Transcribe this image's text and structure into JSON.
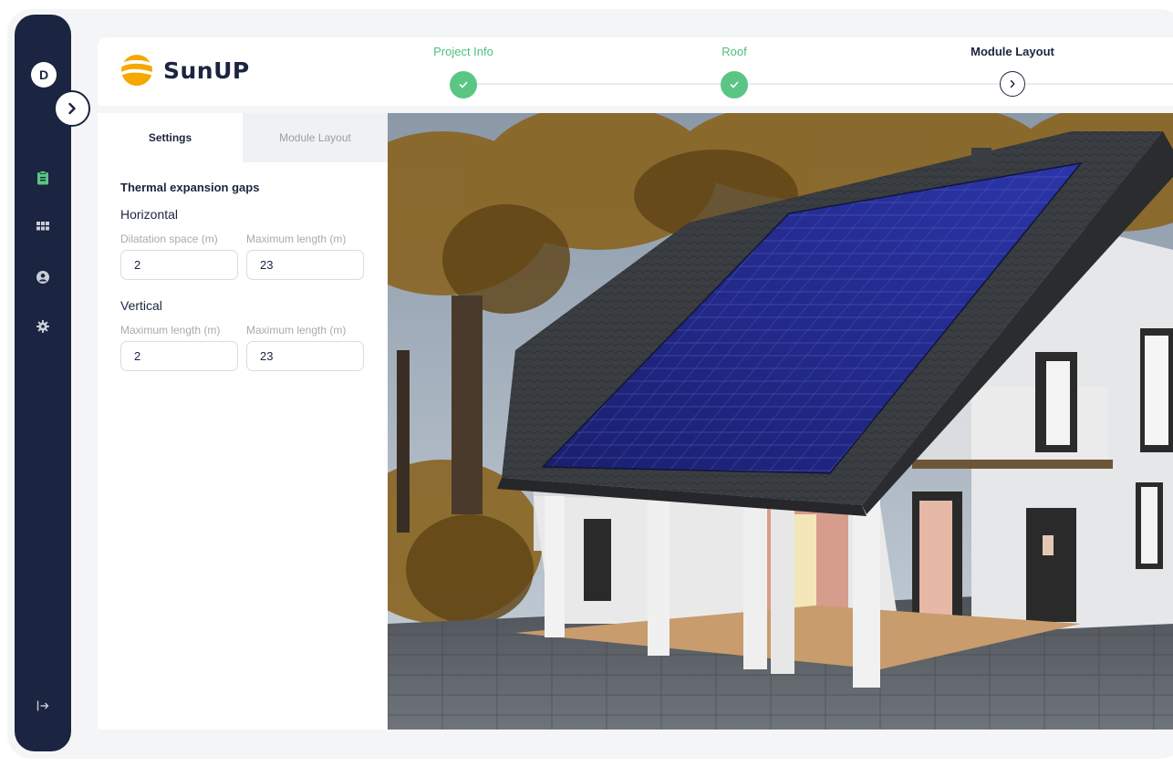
{
  "user": {
    "initial": "D"
  },
  "sidebar": {
    "items": [
      {
        "name": "clipboard-icon",
        "active": true
      },
      {
        "name": "grid-icon",
        "active": false
      },
      {
        "name": "user-icon",
        "active": false
      },
      {
        "name": "gear-icon",
        "active": false
      }
    ],
    "logout_icon": "logout-icon"
  },
  "brand": {
    "name": "SunUP",
    "color": "#1b2440",
    "accent": "#f5a800"
  },
  "stepper": {
    "steps": [
      {
        "label": "Project Info",
        "status": "done"
      },
      {
        "label": "Roof",
        "status": "done"
      },
      {
        "label": "Module Layout",
        "status": "current"
      }
    ],
    "done_color": "#5bc584"
  },
  "panel": {
    "tabs": [
      {
        "label": "Settings",
        "active": true
      },
      {
        "label": "Module Layout",
        "active": false
      }
    ],
    "section_title": "Thermal expansion gaps",
    "horizontal": {
      "label": "Horizontal",
      "fields": [
        {
          "label": "Dilatation space (m)",
          "value": "2"
        },
        {
          "label": "Maximum length (m)",
          "value": "23"
        }
      ]
    },
    "vertical": {
      "label": "Vertical",
      "fields": [
        {
          "label": "Maximum length (m)",
          "value": "2"
        },
        {
          "label": "Maximum length (m)",
          "value": "23"
        }
      ]
    }
  }
}
